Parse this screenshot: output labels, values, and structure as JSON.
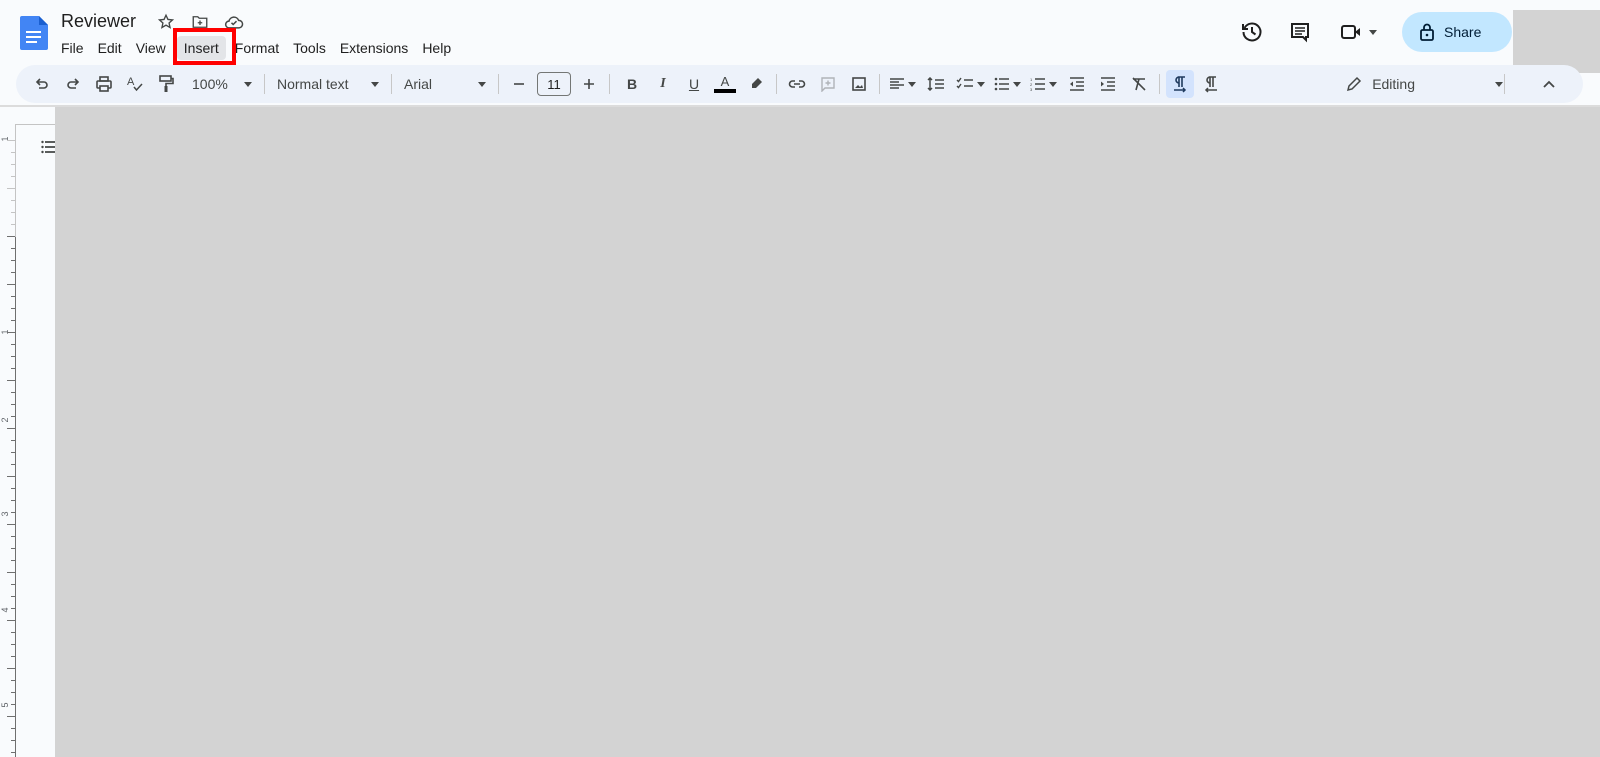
{
  "app": {
    "document_title": "Reviewer",
    "brand_color": "#4285f4"
  },
  "menubar": {
    "items": [
      {
        "label": "File"
      },
      {
        "label": "Edit"
      },
      {
        "label": "View"
      },
      {
        "label": "Insert",
        "highlighted": true
      },
      {
        "label": "Format"
      },
      {
        "label": "Tools"
      },
      {
        "label": "Extensions"
      },
      {
        "label": "Help"
      }
    ]
  },
  "title_icons": [
    "star-icon",
    "move-to-folder-icon",
    "cloud-saved-icon"
  ],
  "actions": {
    "history_icon": "history-icon",
    "comments_icon": "comments-icon",
    "meet_icon": "video-camera-icon",
    "share_label": "Share",
    "share_color": "#c2e7ff"
  },
  "toolbar": {
    "zoom": "100%",
    "style": "Normal text",
    "font": "Arial",
    "font_size": "11",
    "text_color": "#000000",
    "mode": "Editing",
    "buttons": [
      "undo",
      "redo",
      "print",
      "spellcheck",
      "paint-format",
      "bold",
      "italic",
      "underline",
      "text-color",
      "highlight",
      "link",
      "add-comment",
      "insert-image",
      "align",
      "line-spacing",
      "checklist",
      "bulleted-list",
      "numbered-list",
      "decrease-indent",
      "increase-indent",
      "clear-formatting",
      "ltr",
      "rtl"
    ]
  },
  "ruler": {
    "labels": [
      "1",
      "1",
      "2",
      "3",
      "4",
      "5"
    ]
  },
  "annotation": {
    "highlight_color": "#ff0000",
    "target": "Insert"
  }
}
